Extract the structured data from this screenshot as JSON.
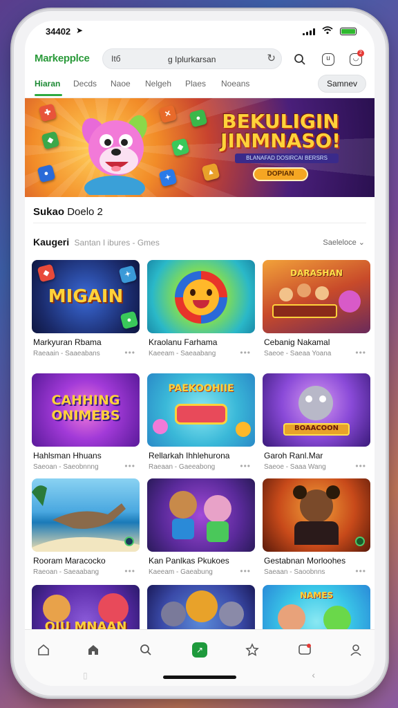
{
  "status": {
    "time": "34402",
    "location_glyph": "➤"
  },
  "header": {
    "brand": "Markepplce",
    "search": {
      "left": "Itб",
      "center": "g Iplurkarsan"
    },
    "icons": [
      "search-icon",
      "tab-switcher-icon",
      "notification-icon"
    ],
    "badge": "2"
  },
  "tabs": {
    "items": [
      "Hiaran",
      "Decds",
      "Naoe",
      "Nelgeh",
      "Plaes",
      "Noeans"
    ],
    "action": "Samnev"
  },
  "hero": {
    "title_line1": "BEKULIGIN",
    "title_line2": "JINMNASO!",
    "subtitle": "BLANAFAD DOSIRCAI BERSRS",
    "button": "DOPIAN"
  },
  "section": {
    "title_bold": "Sukao",
    "title_rest": "Doelo 2",
    "subheading_bold": "Kaugeri",
    "subheading_rest": "Santan I ibures - Gmes",
    "sort": "Saeleloce"
  },
  "cards": [
    {
      "thumb_text": "MIGAIN",
      "name": "Markyuran Rbama",
      "meta": "Raeaain - Saaeabans"
    },
    {
      "thumb_text": "",
      "name": "Kraolanu Farhama",
      "meta": "Kaeeam - Saeaabang"
    },
    {
      "thumb_text": "DARASHAN",
      "name": "Cebanig Nakamal",
      "meta": "Saeoe - Saeaa Yoana"
    },
    {
      "thumb_text": "CAHHING ONIMEBS",
      "name": "Hahlsman Hhuans",
      "meta": "Saeoan - Saeobnnng"
    },
    {
      "thumb_text": "PAEKOOHIIE",
      "name": "Rellarkah Ihhlehurona",
      "meta": "Raeaan - Gaeeabong"
    },
    {
      "thumb_text": "BOAACOON",
      "name": "Garoh Ranl.Mar",
      "meta": "Saeoe - Saaa Wang"
    },
    {
      "thumb_text": "",
      "name": "Rooram Maracocko",
      "meta": "Raeoan - Saeaabang"
    },
    {
      "thumb_text": "",
      "name": "Kan Panlkas Pkukoes",
      "meta": "Kaeeam - Gaeabung"
    },
    {
      "thumb_text": "",
      "name": "Gestabnan Morloohes",
      "meta": "Saeaan - Saoobnns"
    },
    {
      "thumb_text": "OJU MNAAN",
      "name": "",
      "meta": ""
    },
    {
      "thumb_text": "",
      "name": "",
      "meta": ""
    },
    {
      "thumb_text": "NAMES",
      "name": "",
      "meta": ""
    }
  ],
  "bottom_nav": {
    "items": [
      "home-outline-icon",
      "home-icon",
      "search-icon",
      "active-tab-icon",
      "star-icon",
      "messages-icon",
      "profile-icon"
    ],
    "active_index": 3,
    "active_glyph": "↗",
    "badge_color": "#e53935"
  },
  "colors": {
    "brand": "#2a9a3a",
    "accent": "#1e9a3c"
  }
}
